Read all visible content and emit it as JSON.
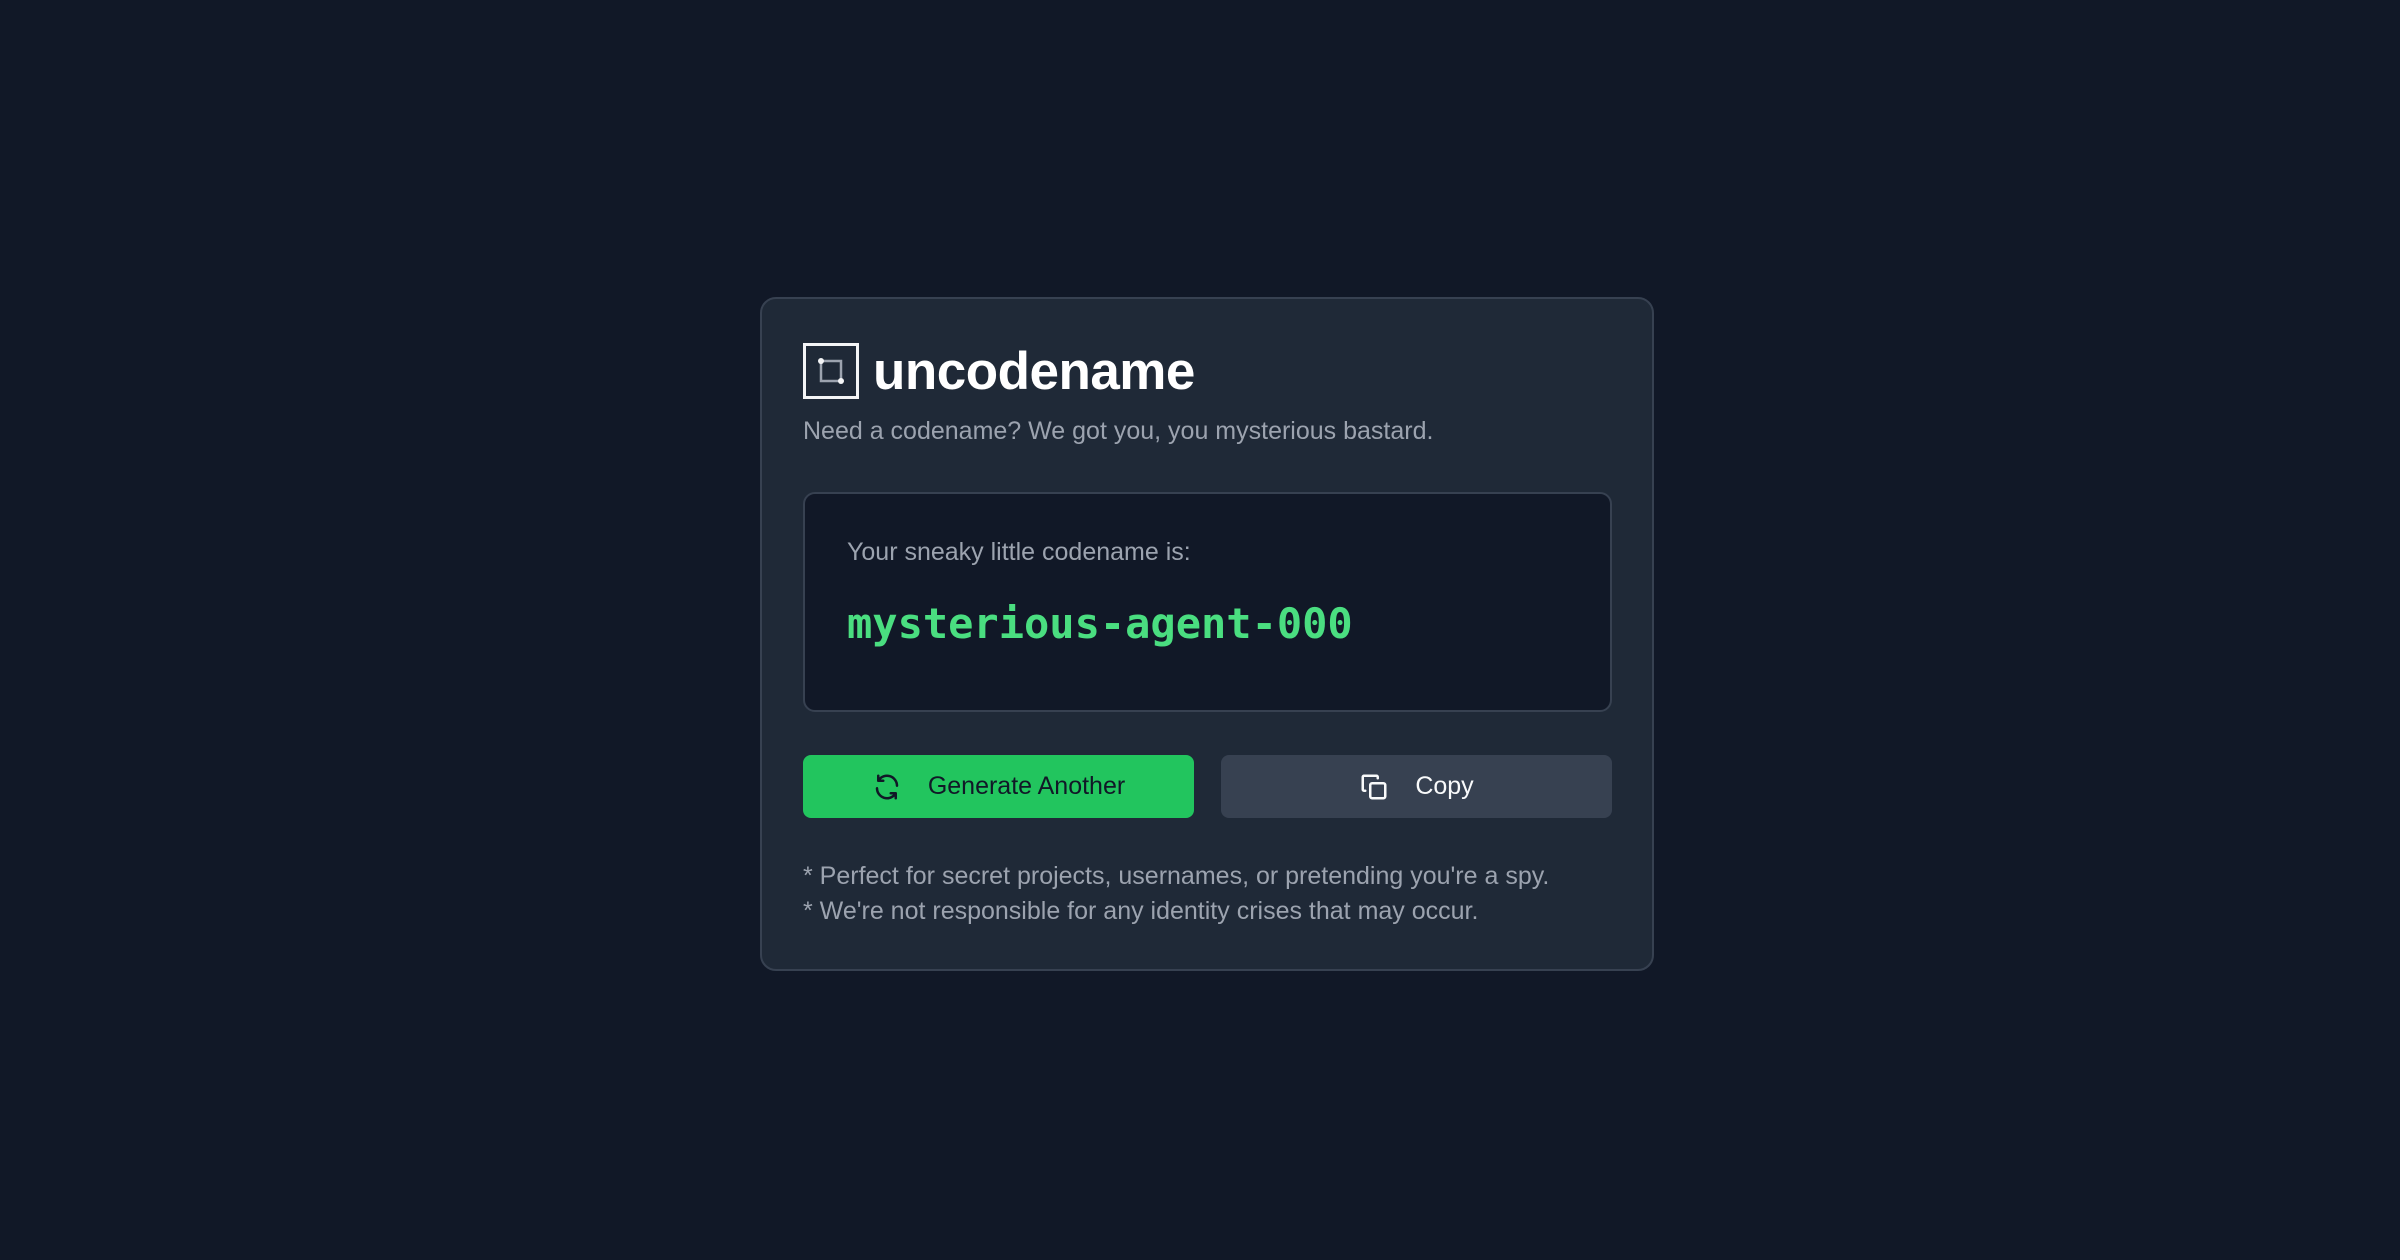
{
  "app": {
    "title": "uncodename",
    "subtitle": "Need a codename? We got you, you mysterious bastard.",
    "logo_icon": "crop-frame-icon"
  },
  "result": {
    "label": "Your sneaky little codename is:",
    "codename": "mysterious-agent-000"
  },
  "actions": {
    "generate_label": "Generate Another",
    "generate_icon": "refresh-icon",
    "copy_label": "Copy",
    "copy_icon": "copy-icon"
  },
  "notes": [
    "* Perfect for secret projects, usernames, or pretending you're a spy.",
    "* We're not responsible for any identity crises that may occur."
  ],
  "colors": {
    "page_background": "#111827",
    "card_background": "#1f2937",
    "accent": "#22c55e",
    "codename_text": "#4ade80",
    "secondary_button": "#374151",
    "muted_text": "#9ca3af"
  }
}
